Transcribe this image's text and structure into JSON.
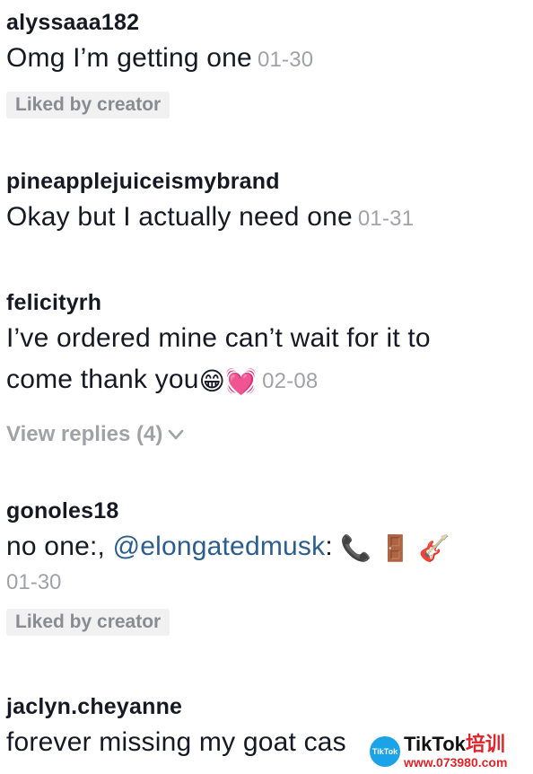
{
  "comments": [
    {
      "username": "alyssaaa182",
      "text": "Omg I’m getting one",
      "date": "01-30",
      "badge": "Liked by creator"
    },
    {
      "username": "pineapplejuiceismybrand",
      "text": "Okay but I actually need one",
      "date": "01-31"
    },
    {
      "username": "felicityrh",
      "text_line1": "I’ve ordered mine can’t wait for it to",
      "text_line2": "come thank you",
      "emojis": [
        "😁",
        "💓"
      ],
      "date": "02-08",
      "view_replies": "View replies (4)"
    },
    {
      "username": "gonoles18",
      "text_prefix": "no one:, ",
      "mention": "@elongatedmusk",
      "text_suffix": ": ",
      "emojis": [
        "📞",
        "🚪",
        "🎸"
      ],
      "date": "01-30",
      "badge": "Liked by creator"
    },
    {
      "username": "jaclyn.cheyanne",
      "text": "forever missing my goat cas"
    }
  ],
  "watermark": {
    "logo_text": "TikTok",
    "title": "TikTok",
    "title_cn": "培训",
    "url": "www.073980.com"
  }
}
